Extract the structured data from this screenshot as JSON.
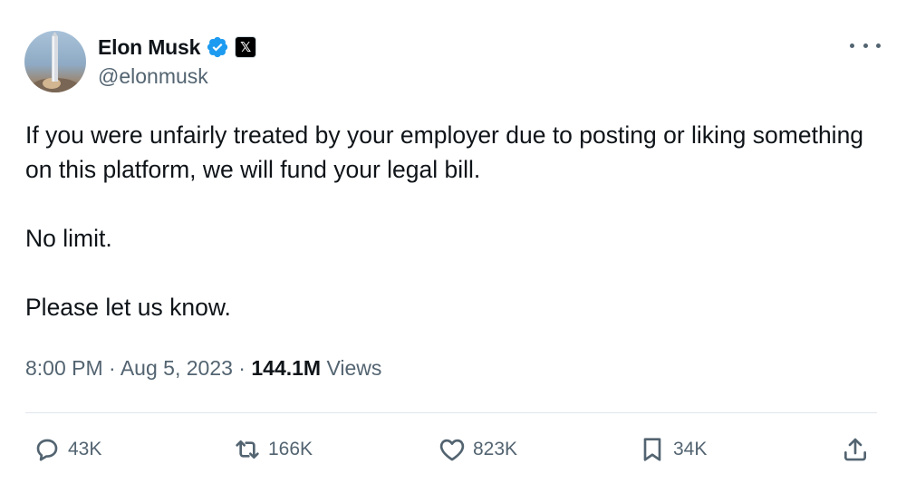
{
  "author": {
    "display_name": "Elon Musk",
    "handle": "@elonmusk",
    "verified_color": "#1d9bf0",
    "affiliate_badge": "𝕏"
  },
  "tweet": {
    "lines": [
      "If you were unfairly treated by your employer due to posting or liking something on this platform, we will fund your legal bill.",
      "No limit.",
      "Please let us know."
    ]
  },
  "meta": {
    "time": "8:00 PM",
    "separator": "·",
    "date": "Aug 5, 2023",
    "views_count": "144.1M",
    "views_label": "Views"
  },
  "actions": {
    "replies": "43K",
    "reposts": "166K",
    "likes": "823K",
    "bookmarks": "34K"
  },
  "icons": {
    "reply": "reply-icon",
    "repost": "repost-icon",
    "like": "heart-icon",
    "bookmark": "bookmark-icon",
    "share": "share-icon",
    "more": "more-icon"
  },
  "colors": {
    "text": "#0f1419",
    "secondary": "#536471",
    "divider": "#e1e6ea"
  }
}
